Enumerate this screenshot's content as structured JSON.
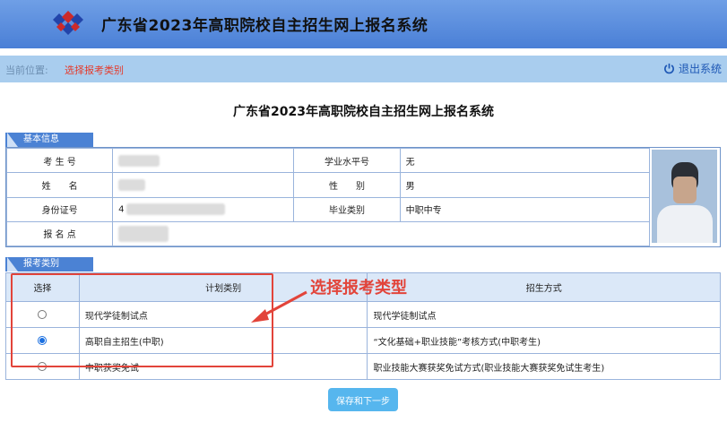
{
  "header": {
    "title": "广东省2023年高职院校自主招生网上报名系统"
  },
  "locbar": {
    "prefix": "当前位置:",
    "current": "选择报考类别",
    "logout_label": "退出系统"
  },
  "page_title": "广东省2023年高职院校自主招生网上报名系统",
  "basic_info": {
    "section_label": "基本信息",
    "labels": {
      "exam_no": "考 生 号",
      "name": "姓　　名",
      "id_no": "身份证号",
      "site": "报 名 点",
      "level_no": "学业水平号",
      "gender": "性　　别",
      "grad_type": "毕业类别"
    },
    "values": {
      "exam_no": "",
      "name": "",
      "id_no": "4",
      "site": "",
      "level_no": "无",
      "gender": "男",
      "grad_type": "中职中专"
    }
  },
  "selection": {
    "section_label": "报考类别",
    "headers": {
      "select": "选择",
      "plan": "计划类别",
      "method": "招生方式"
    },
    "rows": [
      {
        "plan": "现代学徒制试点",
        "method": "现代学徒制试点",
        "selected": false
      },
      {
        "plan": "高职自主招生(中职)",
        "method": "“文化基础+职业技能”考核方式(中职考生)",
        "selected": true
      },
      {
        "plan": "中职获奖免试",
        "method": "职业技能大赛获奖免试方式(职业技能大赛获奖免试生考生)",
        "selected": false
      }
    ]
  },
  "annotation": "选择报考类型",
  "submit_label": "保存和下一步"
}
